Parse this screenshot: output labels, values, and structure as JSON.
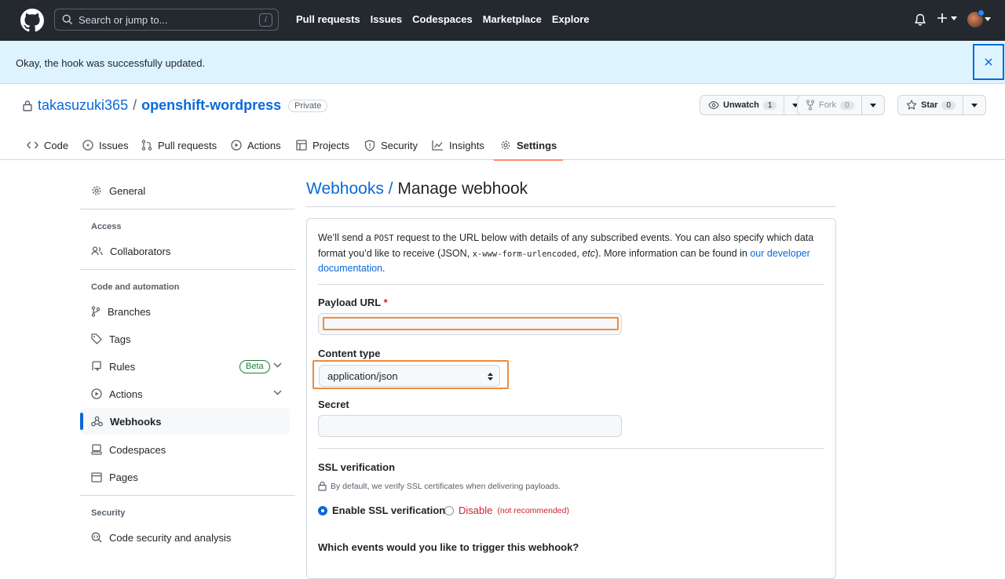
{
  "header": {
    "search_placeholder": "Search or jump to...",
    "search_shortcut": "/",
    "nav": [
      "Pull requests",
      "Issues",
      "Codespaces",
      "Marketplace",
      "Explore"
    ],
    "plus_label": "+"
  },
  "flash": {
    "message": "Okay, the hook was successfully updated.",
    "close_label": "×"
  },
  "repo": {
    "owner": "takasuzuki365",
    "separator": "/",
    "name": "openshift-wordpress",
    "visibility": "Private",
    "unwatch_label": "Unwatch",
    "watch_count": "1",
    "fork_label": "Fork",
    "fork_count": "0",
    "star_label": "Star",
    "star_count": "0"
  },
  "tabs": [
    "Code",
    "Issues",
    "Pull requests",
    "Actions",
    "Projects",
    "Security",
    "Insights",
    "Settings"
  ],
  "sidebar": {
    "general": "General",
    "access_heading": "Access",
    "collaborators": "Collaborators",
    "code_heading": "Code and automation",
    "branches": "Branches",
    "tags": "Tags",
    "rules": "Rules",
    "beta": "Beta",
    "actions": "Actions",
    "webhooks": "Webhooks",
    "codespaces": "Codespaces",
    "pages": "Pages",
    "security_heading": "Security",
    "code_security": "Code security and analysis"
  },
  "main": {
    "crumb": "Webhooks",
    "crumb_sep": " / ",
    "title": "Manage webhook",
    "intro_1": "We’ll send a ",
    "intro_post": "POST",
    "intro_2": " request to the URL below with details of any subscribed events. You can also specify which data format you’d like to receive (JSON, ",
    "intro_form": "x-www-form-urlencoded",
    "intro_3": ", ",
    "intro_etc": "etc",
    "intro_4": "). More information can be found in ",
    "intro_link": "our developer documentation",
    "intro_5": ".",
    "payload_label": "Payload URL",
    "required_mark": "*",
    "payload_value": "",
    "content_type_label": "Content type",
    "content_type_value": "application/json",
    "secret_label": "Secret",
    "secret_value": "",
    "ssl_label": "SSL verification",
    "ssl_note": "By default, we verify SSL certificates when delivering payloads.",
    "ssl_enable": "Enable SSL verification",
    "ssl_disable": "Disable",
    "ssl_disable_note": "(not recommended)",
    "events_question": "Which events would you like to trigger this webhook?"
  },
  "colors": {
    "header_bg": "#24292f",
    "flash_bg": "#ddf4ff",
    "link": "#0969da",
    "tab_underline": "#fd8c73",
    "highlight": "#f08a3b",
    "danger": "#cf222e"
  }
}
